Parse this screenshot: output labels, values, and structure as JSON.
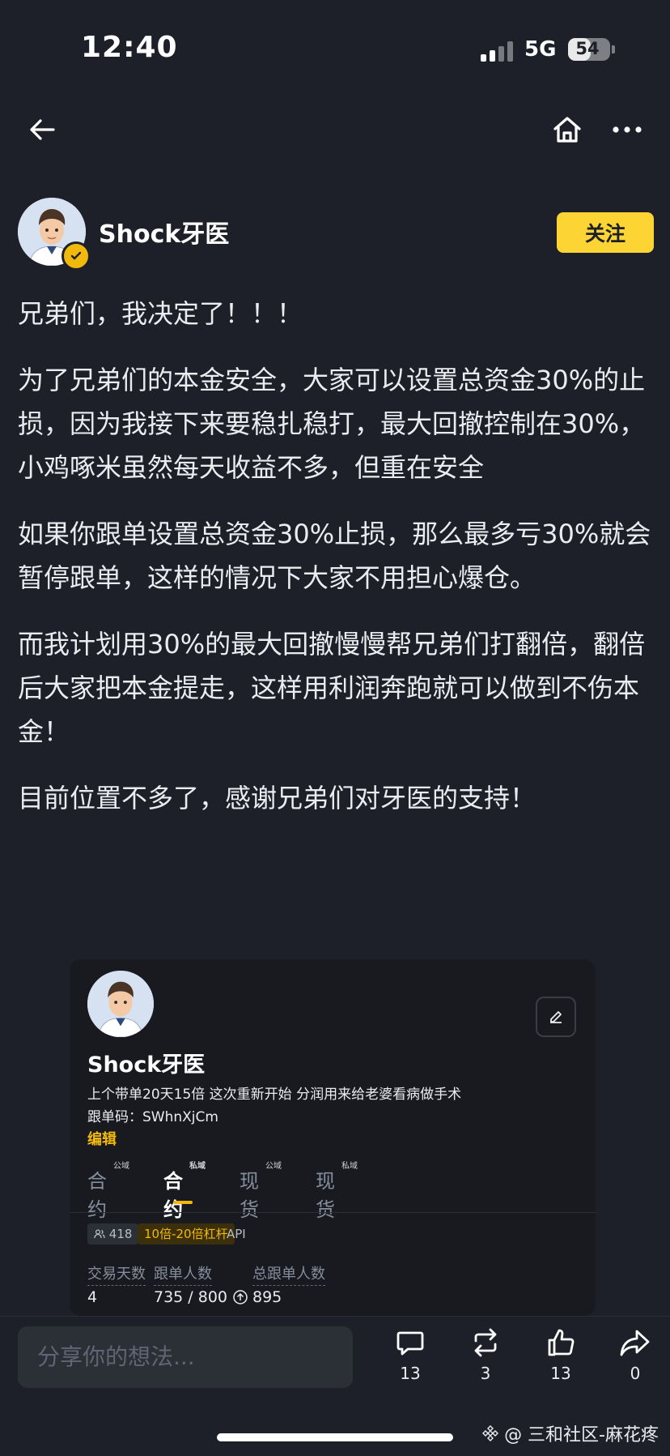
{
  "status_bar": {
    "time": "12:40",
    "network": "5G",
    "battery": "54"
  },
  "author": {
    "name": "Shock牙医",
    "follow_label": "关注"
  },
  "post": {
    "paragraphs": [
      "兄弟们，我决定了！！！",
      "为了兄弟们的本金安全，大家可以设置总资金30%的止损，因为我接下来要稳扎稳打，最大回撤控制在30%，小鸡啄米虽然每天收益不多，但重在安全",
      "如果你跟单设置总资金30%止损，那么最多亏30%就会暂停跟单，这样的情况下大家不用担心爆仓。",
      "而我计划用30%的最大回撤慢慢帮兄弟们打翻倍，翻倍后大家把本金提走，这样用利润奔跑就可以做到不伤本金！",
      "目前位置不多了，感谢兄弟们对牙医的支持！"
    ]
  },
  "embedded": {
    "name": "Shock牙医",
    "bio": "上个带单20天15倍 这次重新开始 分润用来给老婆看病做手术",
    "copy_code": "跟单码：SWhnXjCm",
    "edit_label": "编辑",
    "tabs": [
      {
        "label": "合约",
        "badge": "公域"
      },
      {
        "label": "合约",
        "badge": "私域"
      },
      {
        "label": "现货",
        "badge": "公域"
      },
      {
        "label": "现货",
        "badge": "私域"
      }
    ],
    "followers": "418",
    "leverage": "10倍-20倍杠杆",
    "api": "API",
    "stats": [
      {
        "label": "交易天数",
        "value": "4"
      },
      {
        "label": "跟单人数",
        "value": "735 / 800"
      },
      {
        "label": "总跟单人数",
        "value": "895"
      }
    ]
  },
  "bottom": {
    "placeholder": "分享你的想法...",
    "comments": "13",
    "reposts": "3",
    "likes": "13",
    "shares": "0"
  },
  "watermark": "@ 三和社区-麻花疼",
  "colors": {
    "accent": "#fcd535",
    "background": "#1e2029"
  }
}
